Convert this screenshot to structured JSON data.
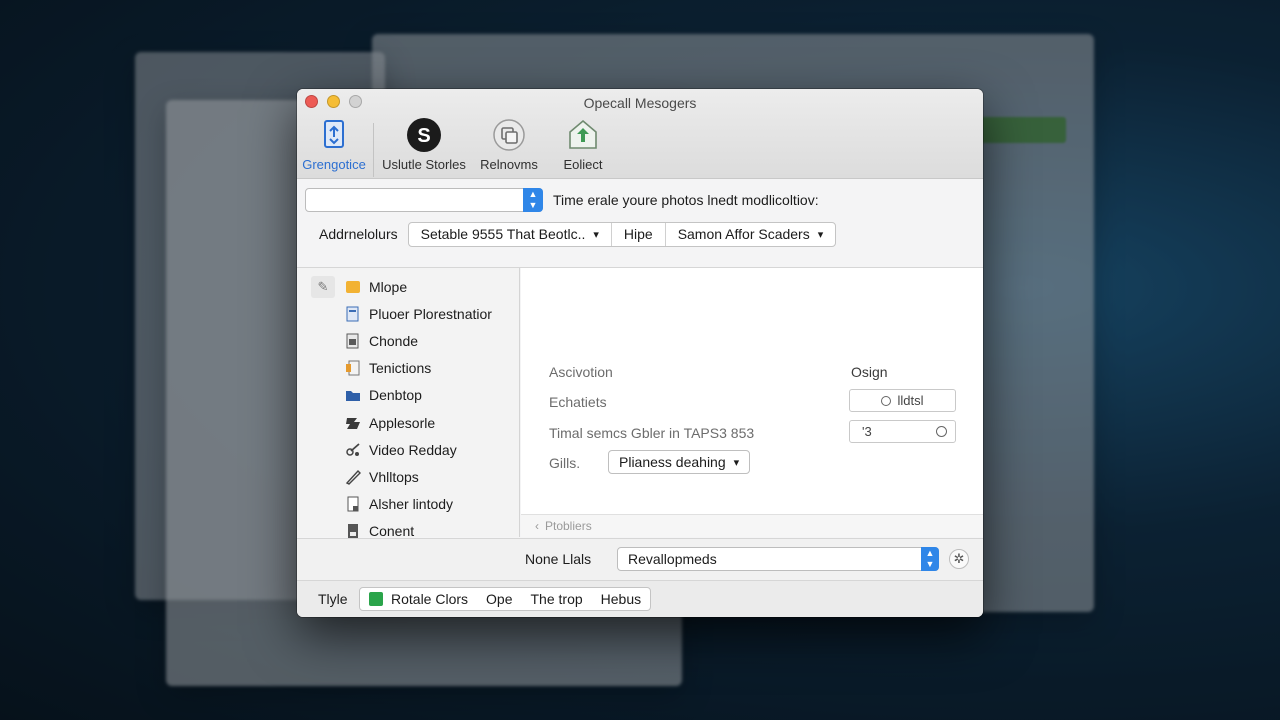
{
  "window": {
    "title": "Opecall Mesogers"
  },
  "toolbar": {
    "items": [
      {
        "label": "Grengotice",
        "icon": "sync-icon"
      },
      {
        "label": "Uslutle Storles",
        "icon": "skype-icon"
      },
      {
        "label": "Relnovms",
        "icon": "copy-icon"
      },
      {
        "label": "Eoliect",
        "icon": "upload-icon"
      }
    ]
  },
  "row1": {
    "hint": "Time erale youre photos lnedt modlicoltiov:"
  },
  "row2": {
    "label": "Addrnelolurs",
    "seg": [
      "Setable 9555 That Beotlc..",
      "Hipe",
      "Samon Affor Scaders"
    ]
  },
  "sidebar": {
    "items": [
      {
        "label": "Mlope",
        "icon": "folder-icon"
      },
      {
        "label": "Pluoer Plorestnatior",
        "icon": "document-icon"
      },
      {
        "label": "Chonde",
        "icon": "document-icon"
      },
      {
        "label": "Tenictions",
        "icon": "notes-icon"
      },
      {
        "label": "Denbtop",
        "icon": "desktop-folder-icon"
      },
      {
        "label": "Applesorle",
        "icon": "apps-icon"
      },
      {
        "label": "Video Redday",
        "icon": "video-icon"
      },
      {
        "label": "Vhlltops",
        "icon": "brush-icon"
      },
      {
        "label": "Alsher lintody",
        "icon": "document-icon"
      },
      {
        "label": "Conent",
        "icon": "document-icon"
      }
    ]
  },
  "detail": {
    "col1": "Ascivotion",
    "col2": "Osign",
    "row1_label": "Echatiets",
    "row1_value": "lldtsl",
    "row2_label": "Timal semcs Gbler in TAPS3 853",
    "row2_value": "'3",
    "row3_label": "Gills.",
    "row3_popup": "Plianess deahing",
    "footer": "Ptobliers"
  },
  "bottom1": {
    "label": "None Llals",
    "select": "Revallopmeds"
  },
  "bottom2": {
    "label": "Tlyle",
    "seg": [
      "Rotale Clors",
      "Ope",
      "The trop",
      "Hebus"
    ]
  },
  "colors": {
    "accent": "#2f86e8",
    "active_tab": "#2c6fd1",
    "green": "#2aa44a"
  }
}
